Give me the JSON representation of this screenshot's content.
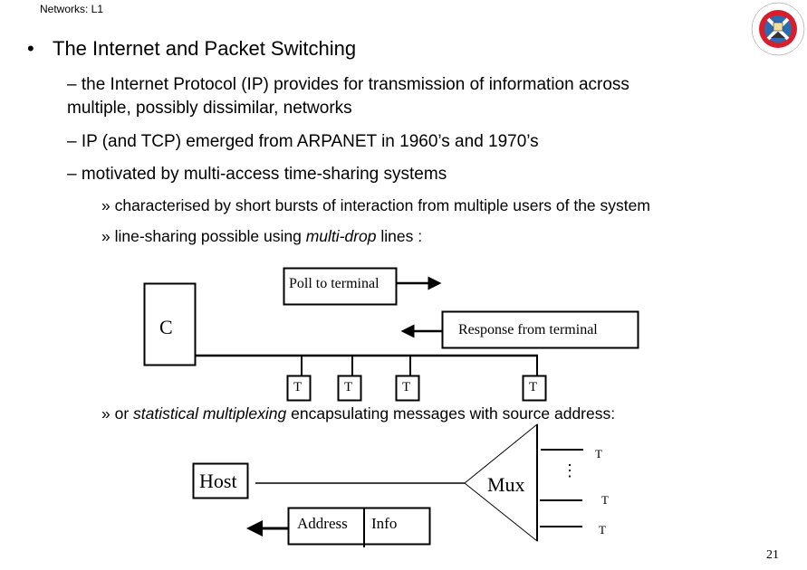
{
  "header": {
    "course_label": "Networks: L1"
  },
  "logo": {
    "name": "University of Edinburgh crest",
    "colors": {
      "ring": "#d81e2c",
      "saltire": "#2b6cb0",
      "white": "#ffffff"
    }
  },
  "slide": {
    "title_bullet": "•",
    "title": "The Internet and Packet Switching",
    "points": [
      {
        "text_line1": "– the Internet Protocol (IP) provides for transmission of information across",
        "text_line2": "multiple, possibly dissimilar, networks"
      },
      {
        "text": "– IP (and TCP) emerged from ARPANET in 1960’s and 1970’s"
      },
      {
        "text": "– motivated by multi-access time-sharing systems"
      }
    ],
    "subpoints": [
      {
        "text": "» characterised by short bursts of interaction from multiple users of the system"
      },
      {
        "prefix": "» line-sharing possible using ",
        "emphasis": "multi-drop",
        "suffix": " lines :"
      },
      {
        "prefix": "» or ",
        "emphasis": "statistical multiplexing",
        "suffix": " encapsulating messages with source address:"
      }
    ]
  },
  "multidrop_diagram": {
    "controller_label": "C",
    "poll_label": "Poll to terminal",
    "response_label": "Response from terminal",
    "terminals": [
      "T",
      "T",
      "T",
      "T"
    ]
  },
  "mux_diagram": {
    "host_label": "Host",
    "mux_label": "Mux",
    "packet_fields": [
      "Address",
      "Info"
    ],
    "ellipsis": "⋮",
    "terminals": [
      "T",
      "T",
      "T"
    ]
  },
  "footer": {
    "page_number": "21"
  }
}
